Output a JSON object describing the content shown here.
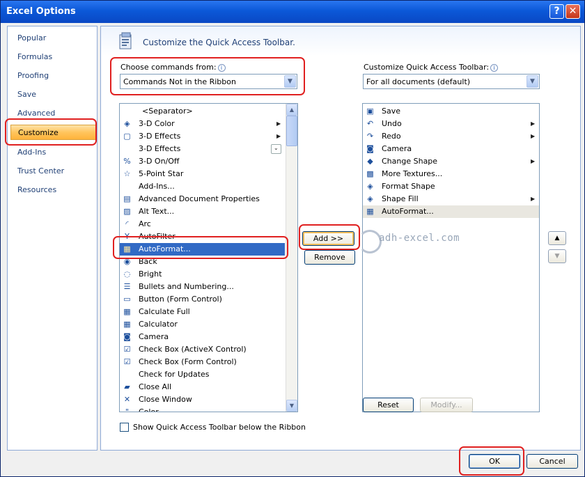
{
  "window": {
    "title": "Excel Options",
    "help_label": "?",
    "close_label": "✕"
  },
  "nav": {
    "items": [
      {
        "label": "Popular"
      },
      {
        "label": "Formulas"
      },
      {
        "label": "Proofing"
      },
      {
        "label": "Save"
      },
      {
        "label": "Advanced"
      },
      {
        "label": "Customize",
        "selected": true
      },
      {
        "label": "Add-Ins"
      },
      {
        "label": "Trust Center"
      },
      {
        "label": "Resources"
      }
    ]
  },
  "header": {
    "title": "Customize the Quick Access Toolbar."
  },
  "choose_commands": {
    "label": "Choose commands from:",
    "value": "Commands Not in the Ribbon",
    "info": "i"
  },
  "customize_qat": {
    "label": "Customize Quick Access Toolbar:",
    "value": "For all documents (default)",
    "info": "i"
  },
  "commands_list": [
    {
      "label": "<Separator>",
      "icon": ""
    },
    {
      "label": "3-D Color",
      "icon": "paint-bucket-icon",
      "glyph": "◈",
      "submenu": true
    },
    {
      "label": "3-D Effects",
      "icon": "cube-icon",
      "glyph": "▢",
      "submenu": true
    },
    {
      "label": "3-D Effects",
      "icon": "",
      "glyph": "",
      "dropdown": true
    },
    {
      "label": "3-D On/Off",
      "icon": "toggle-3d-icon",
      "glyph": "%"
    },
    {
      "label": "5-Point Star",
      "icon": "star-icon",
      "glyph": "☆"
    },
    {
      "label": "Add-Ins...",
      "icon": "",
      "glyph": ""
    },
    {
      "label": "Advanced Document Properties",
      "icon": "document-properties-icon",
      "glyph": "▤"
    },
    {
      "label": "Alt Text...",
      "icon": "alt-text-icon",
      "glyph": "▨"
    },
    {
      "label": "Arc",
      "icon": "arc-icon",
      "glyph": "◜"
    },
    {
      "label": "AutoFilter",
      "icon": "autofilter-icon",
      "glyph": "Y"
    },
    {
      "label": "AutoFormat...",
      "icon": "autoformat-icon",
      "glyph": "▦",
      "selected": true
    },
    {
      "label": "Back",
      "icon": "back-icon",
      "glyph": "◉"
    },
    {
      "label": "Bright",
      "icon": "bright-icon",
      "glyph": "◌"
    },
    {
      "label": "Bullets and Numbering...",
      "icon": "bullets-icon",
      "glyph": "☰"
    },
    {
      "label": "Button (Form Control)",
      "icon": "form-button-icon",
      "glyph": "▭"
    },
    {
      "label": "Calculate Full",
      "icon": "calculate-full-icon",
      "glyph": "▦"
    },
    {
      "label": "Calculator",
      "icon": "calculator-icon",
      "glyph": "▦"
    },
    {
      "label": "Camera",
      "icon": "camera-icon",
      "glyph": "◙"
    },
    {
      "label": "Check Box (ActiveX Control)",
      "icon": "checkbox-icon",
      "glyph": "☑"
    },
    {
      "label": "Check Box (Form Control)",
      "icon": "checkbox-icon",
      "glyph": "☑"
    },
    {
      "label": "Check for Updates",
      "icon": "",
      "glyph": ""
    },
    {
      "label": "Close All",
      "icon": "folder-icon",
      "glyph": "▰"
    },
    {
      "label": "Close Window",
      "icon": "close-window-icon",
      "glyph": "✕"
    },
    {
      "label": "Color",
      "icon": "color-icon",
      "glyph": "\""
    }
  ],
  "qat_list": [
    {
      "label": "Save",
      "icon": "save-icon",
      "glyph": "▣"
    },
    {
      "label": "Undo",
      "icon": "undo-icon",
      "glyph": "↶",
      "submenu": true
    },
    {
      "label": "Redo",
      "icon": "redo-icon",
      "glyph": "↷",
      "submenu": true
    },
    {
      "label": "Camera",
      "icon": "camera-icon",
      "glyph": "◙"
    },
    {
      "label": "Change Shape",
      "icon": "change-shape-icon",
      "glyph": "◆",
      "submenu": true
    },
    {
      "label": "More Textures...",
      "icon": "textures-icon",
      "glyph": "▩"
    },
    {
      "label": "Format Shape",
      "icon": "format-shape-icon",
      "glyph": "◈"
    },
    {
      "label": "Shape Fill",
      "icon": "shape-fill-icon",
      "glyph": "◈",
      "submenu": true
    },
    {
      "label": "AutoFormat...",
      "icon": "autoformat-icon",
      "glyph": "▦",
      "highlighted": true
    }
  ],
  "buttons": {
    "add": "Add >>",
    "remove": "Remove",
    "reset": "Reset",
    "modify": "Modify...",
    "ok": "OK",
    "cancel": "Cancel",
    "move_up": "▲",
    "move_down": "▼"
  },
  "show_below_ribbon": {
    "label": "Show Quick Access Toolbar below the Ribbon",
    "checked": false
  },
  "watermark": {
    "text": "adh-excel.com"
  }
}
